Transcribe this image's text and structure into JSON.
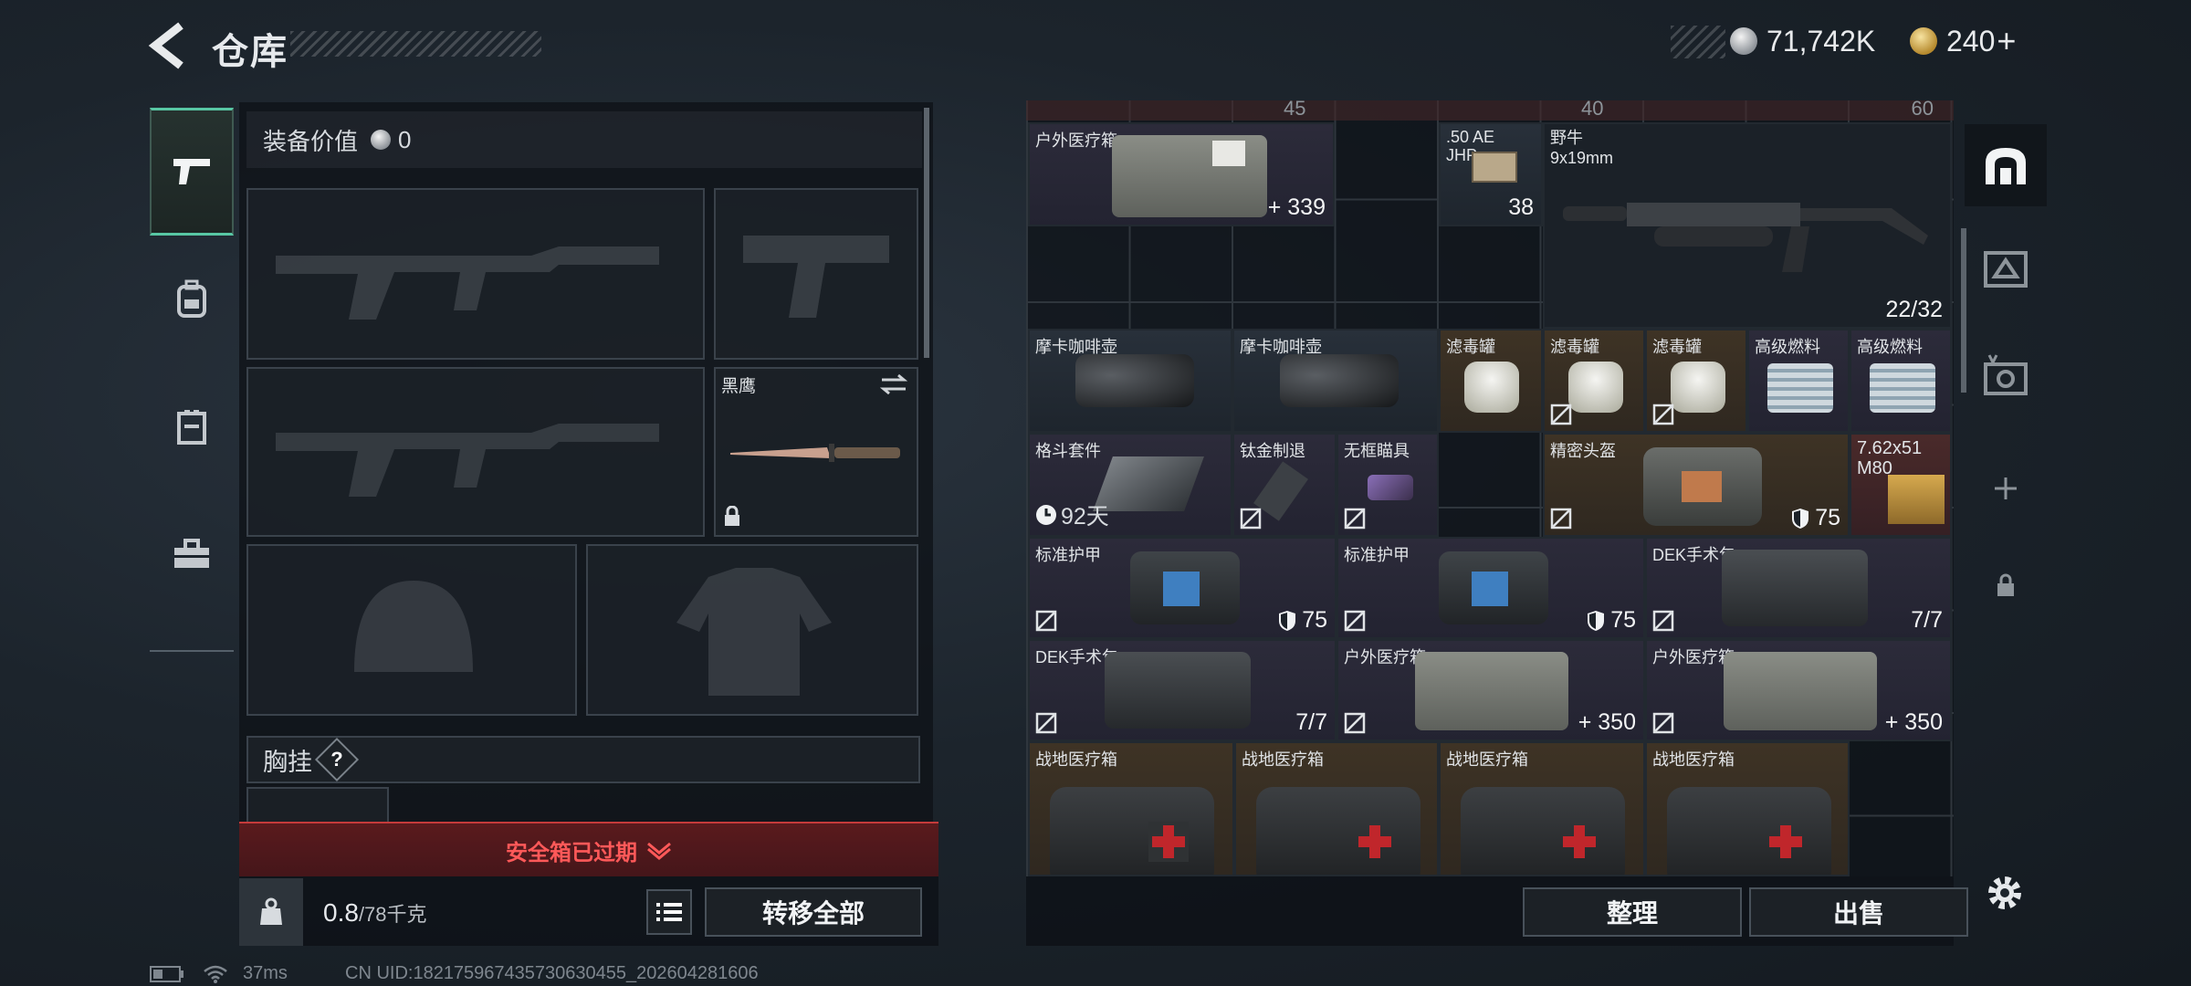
{
  "header": {
    "title": "仓库",
    "silver_amount": "71,742K",
    "gold_amount": "240",
    "gold_plus": "+"
  },
  "rail": {
    "items": [
      "pistol-icon",
      "backpack-icon",
      "vest-icon",
      "toolbox-icon"
    ]
  },
  "equipment": {
    "value_label": "装备价值",
    "value": "0",
    "knife_name": "黑鹰",
    "chest_label": "胸挂",
    "chest_help": "?",
    "alert": "安全箱已过期",
    "weight_value": "0.8",
    "weight_cap": "/78千克",
    "transfer_all": "转移全部"
  },
  "inventory": {
    "top_row": [
      "45",
      "40",
      "60"
    ],
    "items": [
      {
        "name": "户外医疗箱",
        "count": "339",
        "prefix": "+"
      },
      {
        "name": ".50 AE JHP",
        "count": "38"
      },
      {
        "name": "野牛 9x19mm",
        "count": "22/32"
      },
      {
        "name": "摩卡咖啡壶"
      },
      {
        "name": "摩卡咖啡壶"
      },
      {
        "name": "滤毒罐"
      },
      {
        "name": "滤毒罐"
      },
      {
        "name": "滤毒罐"
      },
      {
        "name": "高级燃料"
      },
      {
        "name": "高级燃料"
      },
      {
        "name": "格斗套件",
        "count": "92天"
      },
      {
        "name": "钛金制退"
      },
      {
        "name": "无框瞄具"
      },
      {
        "name": "精密头盔",
        "count": "75"
      },
      {
        "name": "7.62x51 M80"
      },
      {
        "name": "标准护甲",
        "count": "75"
      },
      {
        "name": "标准护甲",
        "count": "75"
      },
      {
        "name": "DEK手术包",
        "count": "7/7"
      },
      {
        "name": "DEK手术包",
        "count": "7/7"
      },
      {
        "name": "户外医疗箱",
        "count": "350",
        "prefix": "+"
      },
      {
        "name": "户外医疗箱",
        "count": "350",
        "prefix": "+"
      },
      {
        "name": "战地医疗箱"
      },
      {
        "name": "战地医疗箱"
      },
      {
        "name": "战地医疗箱"
      },
      {
        "name": "战地医疗箱"
      }
    ],
    "sort_button": "整理",
    "sell_button": "出售"
  },
  "status": {
    "ping": "37ms",
    "uid": "CN UID:182175967435730630455_202604281606"
  },
  "colors": {
    "accent_green": "#58c7a4",
    "alert_red": "#ff5959",
    "gold": "#d8a944"
  }
}
